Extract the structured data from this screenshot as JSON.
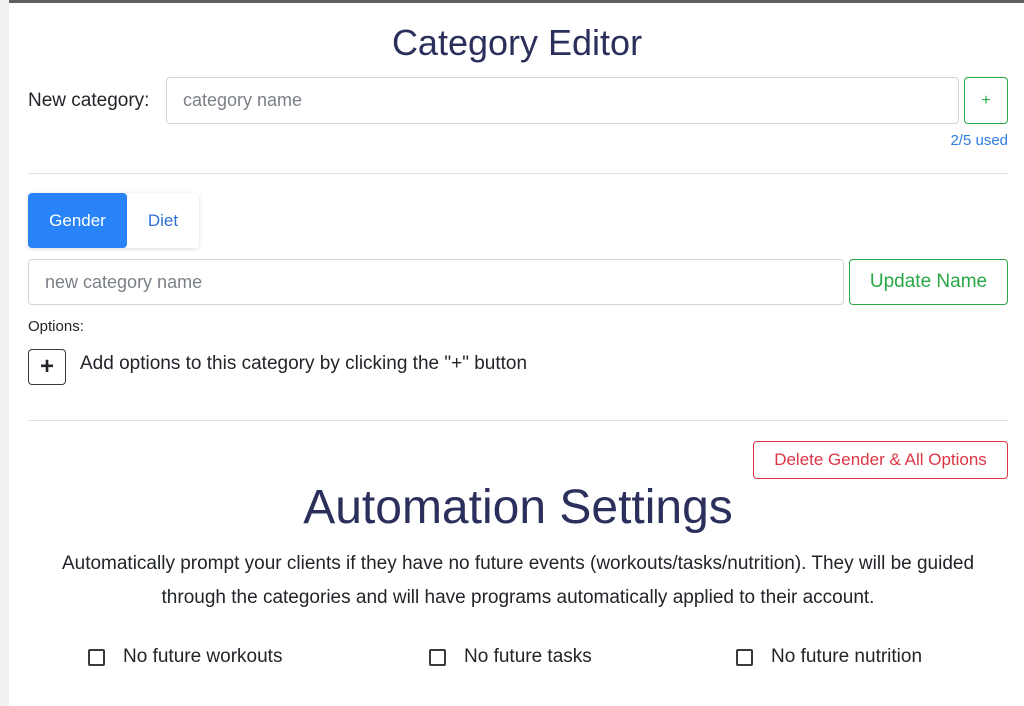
{
  "title": "Category Editor",
  "new_category": {
    "label": "New category:",
    "placeholder": "category name",
    "add_label": "+",
    "usage": "2/5 used"
  },
  "tabs": [
    {
      "label": "Gender",
      "active": true
    },
    {
      "label": "Diet",
      "active": false
    }
  ],
  "category": {
    "rename_placeholder": "new category name",
    "update_label": "Update Name",
    "options_label": "Options:",
    "add_option_label": "+",
    "options_hint": "Add options to this category by clicking the \"+\" button",
    "delete_label": "Delete Gender & All Options"
  },
  "automation": {
    "title": "Automation Settings",
    "description": "Automatically prompt your clients if they have no future events (workouts/tasks/nutrition). They will be guided through the categories and will have programs automatically applied to their account.",
    "checkboxes": [
      {
        "label": "No future workouts",
        "checked": false
      },
      {
        "label": "No future tasks",
        "checked": false
      },
      {
        "label": "No future nutrition",
        "checked": false
      }
    ]
  },
  "colors": {
    "primary": "#2883f8",
    "success": "#28a745",
    "danger": "#dc3545",
    "heading": "#2b2f5b"
  }
}
